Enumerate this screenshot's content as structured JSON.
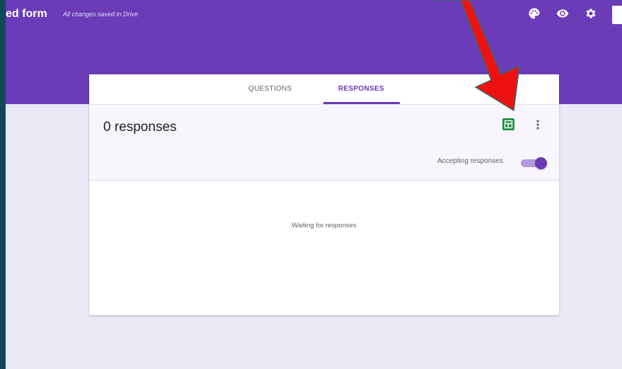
{
  "header": {
    "form_title": "ed form",
    "save_status": "All changes saved in Drive",
    "icons": [
      "palette-icon",
      "eye-icon",
      "gear-icon"
    ]
  },
  "tabs": [
    {
      "label": "QUESTIONS",
      "active": false
    },
    {
      "label": "RESPONSES",
      "active": true
    }
  ],
  "responses": {
    "count_label": "0 responses",
    "accepting_label": "Accepting responses",
    "accepting": true,
    "empty_message": "Waiting for responses"
  },
  "colors": {
    "header": "#6a3cb8",
    "accent": "#673ab7",
    "sheets": "#1e8e3e",
    "annotation_arrow": "#ee1111",
    "background": "#ece8f6"
  }
}
